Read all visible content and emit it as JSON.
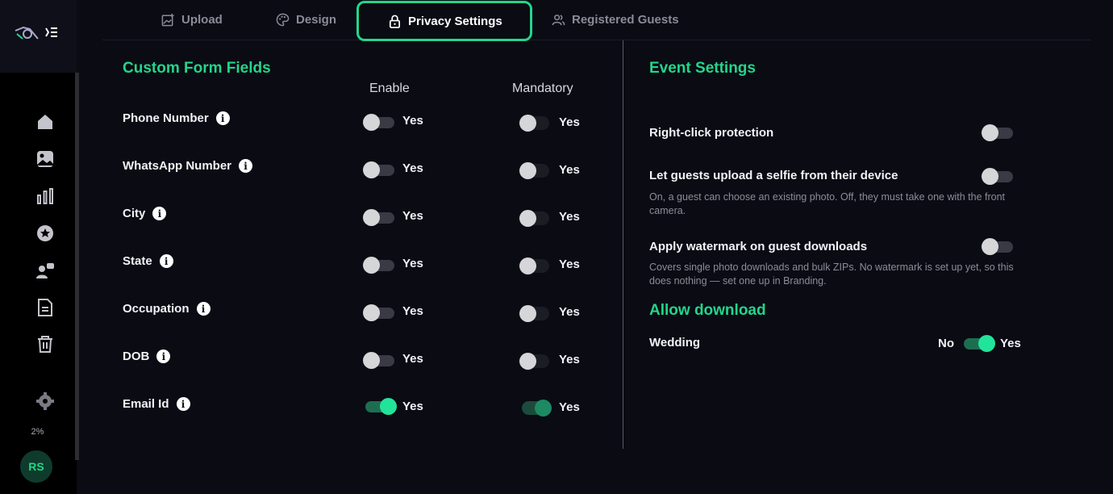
{
  "sidebar": {
    "usage": "2%",
    "avatar_initials": "RS",
    "nav": [
      "home-icon",
      "gallery-icon",
      "analytics-icon",
      "star-icon",
      "users-icon",
      "document-icon",
      "trash-icon",
      "settings-icon"
    ]
  },
  "tabs": [
    {
      "label": "Upload",
      "icon": "upload-icon"
    },
    {
      "label": "Design",
      "icon": "palette-icon"
    },
    {
      "label": "Privacy Settings",
      "icon": "lock-icon",
      "active": true
    },
    {
      "label": "Registered Guests",
      "icon": "guests-icon"
    }
  ],
  "custom_fields": {
    "title": "Custom Form Fields",
    "enable_header": "Enable",
    "mandatory_header": "Mandatory",
    "yes_label": "Yes",
    "fields": [
      {
        "label": "Phone Number",
        "enable": false,
        "mandatory": false
      },
      {
        "label": "WhatsApp Number",
        "enable": false,
        "mandatory": false
      },
      {
        "label": "City",
        "enable": false,
        "mandatory": false
      },
      {
        "label": "State",
        "enable": false,
        "mandatory": false
      },
      {
        "label": "Occupation",
        "enable": false,
        "mandatory": false
      },
      {
        "label": "DOB",
        "enable": false,
        "mandatory": false
      },
      {
        "label": "Email Id",
        "enable": true,
        "mandatory": true
      }
    ]
  },
  "event_settings": {
    "title": "Event Settings",
    "right_click": {
      "label": "Right-click protection",
      "on": false
    },
    "selfie_upload": {
      "label": "Let guests upload a selfie from their device",
      "desc": "On, a guest can choose an existing photo. Off, they must take one with the front camera.",
      "on": false
    },
    "watermark": {
      "label": "Apply watermark on guest downloads",
      "desc": "Covers single photo downloads and bulk ZIPs. No watermark is set up yet, so this does nothing — set one up in Branding.",
      "on": false
    }
  },
  "allow_download": {
    "title": "Allow download",
    "item_label": "Wedding",
    "no_label": "No",
    "yes_label": "Yes",
    "on": true
  },
  "colors": {
    "accent": "#22d68a",
    "background": "#0b0b14"
  }
}
